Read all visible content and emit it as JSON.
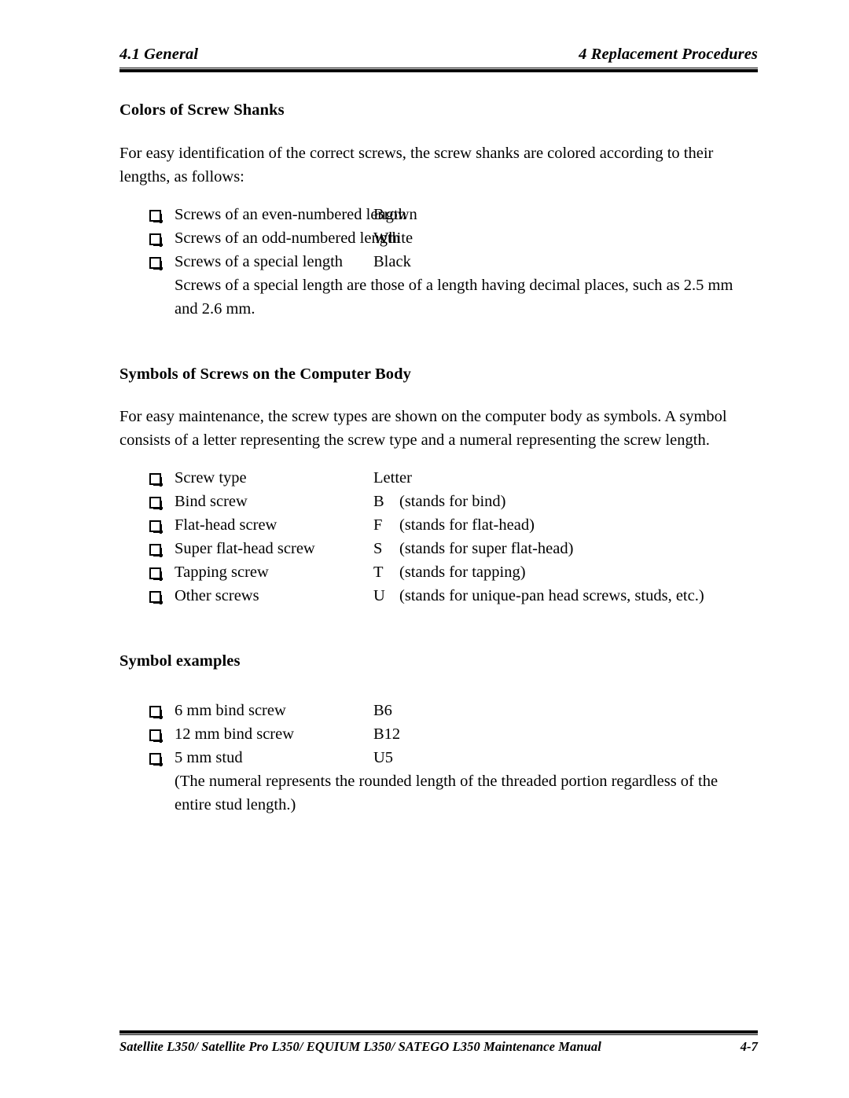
{
  "header": {
    "left": "4.1 General",
    "right": "4 Replacement Procedures"
  },
  "footer": {
    "left": "Satellite L350/ Satellite Pro L350/ EQUIUM L350/ SATEGO L350 Maintenance Manual",
    "right": "4-7"
  },
  "sections": {
    "colors": {
      "heading": "Colors of Screw Shanks",
      "intro": "For easy identification of the correct screws, the screw shanks are colored according to their lengths, as follows:",
      "items": [
        {
          "label": "Screws of an even-numbered length",
          "value": "Brown"
        },
        {
          "label": "Screws of an odd-numbered length",
          "value": "White"
        },
        {
          "label": "Screws of a special length",
          "value": "Black"
        }
      ],
      "continuation": "Screws of a special length are those of a length having decimal places, such as 2.5 mm and 2.6 mm."
    },
    "symbols": {
      "heading": "Symbols of Screws on the Computer Body",
      "intro": "For easy maintenance, the screw types are shown on the computer body as symbols. A symbol consists of a letter representing the screw type and a numeral representing the screw length.",
      "items": [
        {
          "label": "Screw type",
          "code": "Letter",
          "note": ""
        },
        {
          "label": "Bind screw",
          "code": "B",
          "note": "(stands for bind)"
        },
        {
          "label": "Flat-head screw",
          "code": "F",
          "note": "(stands for flat-head)"
        },
        {
          "label": "Super flat-head screw",
          "code": "S",
          "note": "(stands for super flat-head)"
        },
        {
          "label": "Tapping screw",
          "code": "T",
          "note": "(stands for tapping)"
        },
        {
          "label": "Other screws",
          "code": "U",
          "note": "(stands for unique-pan head screws, studs, etc.)"
        }
      ]
    },
    "examples": {
      "heading": "Symbol examples",
      "items": [
        {
          "label": "6 mm bind screw",
          "value": "B6"
        },
        {
          "label": "12 mm bind screw",
          "value": "B12"
        },
        {
          "label": "5 mm stud",
          "value": "U5"
        }
      ],
      "continuation": "(The numeral represents the rounded length of the threaded portion regardless of the entire stud length.)"
    }
  }
}
